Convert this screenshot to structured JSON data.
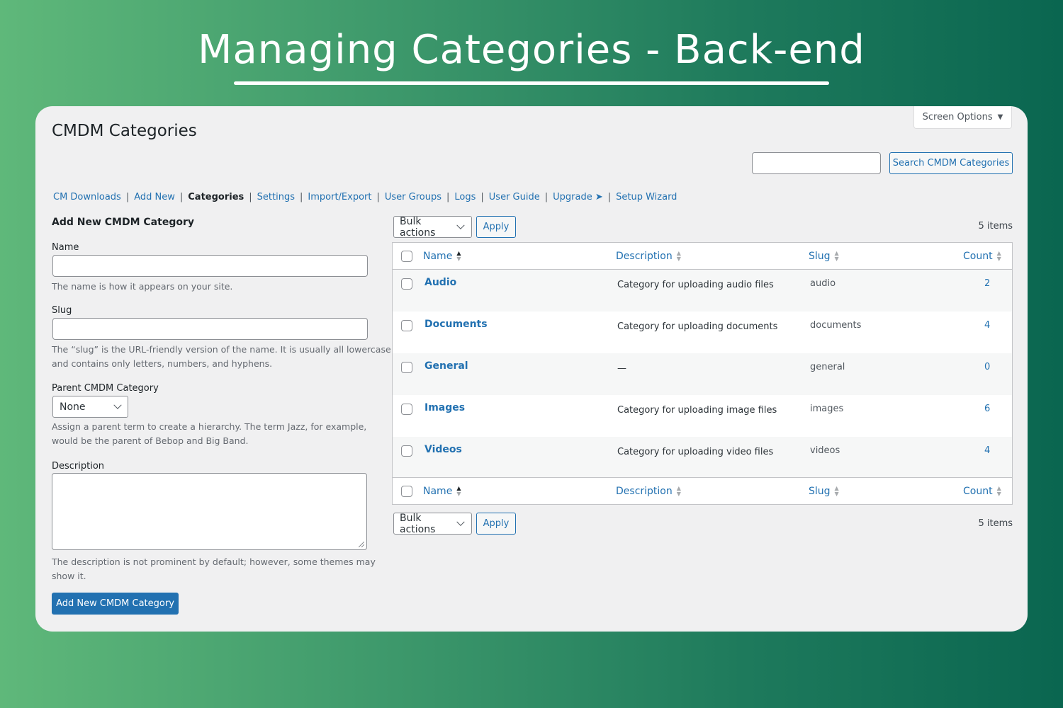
{
  "banner": {
    "title": "Managing Categories - Back-end"
  },
  "screen_options": {
    "label": "Screen Options",
    "arrow": "▼"
  },
  "page_title": "CMDM Categories",
  "search": {
    "placeholder": "",
    "button_label": "Search CMDM Categories"
  },
  "subnav": [
    {
      "label": "CM Downloads",
      "current": false
    },
    {
      "label": "Add New",
      "current": false
    },
    {
      "label": "Categories",
      "current": true
    },
    {
      "label": "Settings",
      "current": false
    },
    {
      "label": "Import/Export",
      "current": false
    },
    {
      "label": "User Groups",
      "current": false
    },
    {
      "label": "Logs",
      "current": false
    },
    {
      "label": "User Guide",
      "current": false
    },
    {
      "label": "Upgrade ➤",
      "current": false
    },
    {
      "label": "Setup Wizard",
      "current": false
    }
  ],
  "form": {
    "title": "Add New CMDM Category",
    "name_label": "Name",
    "name_value": "",
    "name_help": "The name is how it appears on your site.",
    "slug_label": "Slug",
    "slug_value": "",
    "slug_help_1": "The “slug” is the URL-friendly version of the name. It is usually all lowercase",
    "slug_help_2": "and contains only letters, numbers, and hyphens.",
    "parent_label": "Parent CMDM Category",
    "parent_value": "None",
    "parent_help_1": "Assign a parent term to create a hierarchy. The term Jazz, for example,",
    "parent_help_2": "would be the parent of Bebop and Big Band.",
    "description_label": "Description",
    "description_value": "",
    "description_help_1": "The description is not prominent by default; however, some themes may",
    "description_help_2": "show it.",
    "submit_label": "Add New CMDM Category"
  },
  "list": {
    "bulk_actions_label": "Bulk actions",
    "apply_label": "Apply",
    "items_count": "5 items",
    "columns": {
      "name": "Name",
      "description": "Description",
      "slug": "Slug",
      "count": "Count"
    },
    "rows": [
      {
        "name": "Audio",
        "description": "Category for uploading audio files",
        "slug": "audio",
        "count": "2"
      },
      {
        "name": "Documents",
        "description": "Category for uploading documents",
        "slug": "documents",
        "count": "4"
      },
      {
        "name": "General",
        "description": "—",
        "slug": "general",
        "count": "0"
      },
      {
        "name": "Images",
        "description": "Category for uploading image files",
        "slug": "images",
        "count": "6"
      },
      {
        "name": "Videos",
        "description": "Category for uploading video files",
        "slug": "videos",
        "count": "4"
      }
    ]
  },
  "colors": {
    "link": "#2271b1",
    "primary_button": "#2271b1",
    "panel_bg": "#f0f0f1"
  }
}
